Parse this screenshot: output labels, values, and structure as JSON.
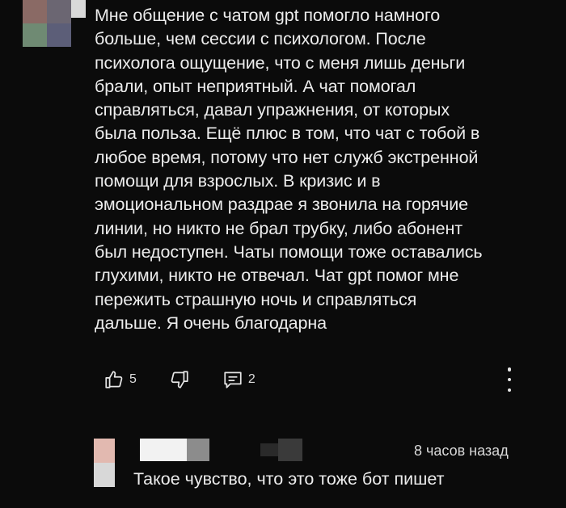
{
  "comment": {
    "lines": [
      "Мне общение с чатом gpt помогло намного",
      "больше, чем сессии с психологом. После",
      "психолога ощущение, что с меня лишь деньги",
      "брали, опыт неприятный. А чат помогал",
      "справляться, давал упражнения, от которых",
      "была польза. Ещё плюс в том, что чат с тобой в",
      "любое время, потому что нет служб экстренной",
      "помощи для взрослых. В кризис и в",
      "эмоциональном раздрае я звонила на горячие",
      "линии, но никто не брал трубку, либо абонент",
      "был недоступен. Чаты помощи тоже оставались",
      "глухими, никто не отвечал. Чат gpt помог мне",
      "пережить страшную ночь и справляться",
      "дальше. Я очень благодарна"
    ],
    "likes": "5",
    "replies": "2",
    "icons": [
      "thumbs-up-icon",
      "thumbs-down-icon",
      "reply-icon",
      "more-vertical-icon"
    ],
    "avatar_colors": [
      "#8a6a65",
      "#6b6672",
      "#6f8a73",
      "#5c5e78"
    ]
  },
  "reply": {
    "timestamp": "8 часов назад",
    "text": "Такое чувство, что это тоже бот пишет",
    "avatar_colors": [
      "#e2b9b0",
      "#d8d8d8"
    ],
    "name_blur_colors": [
      "#f2f2f2",
      "#8c8c8c",
      "#2a2a2a",
      "#3a3a3a"
    ]
  }
}
